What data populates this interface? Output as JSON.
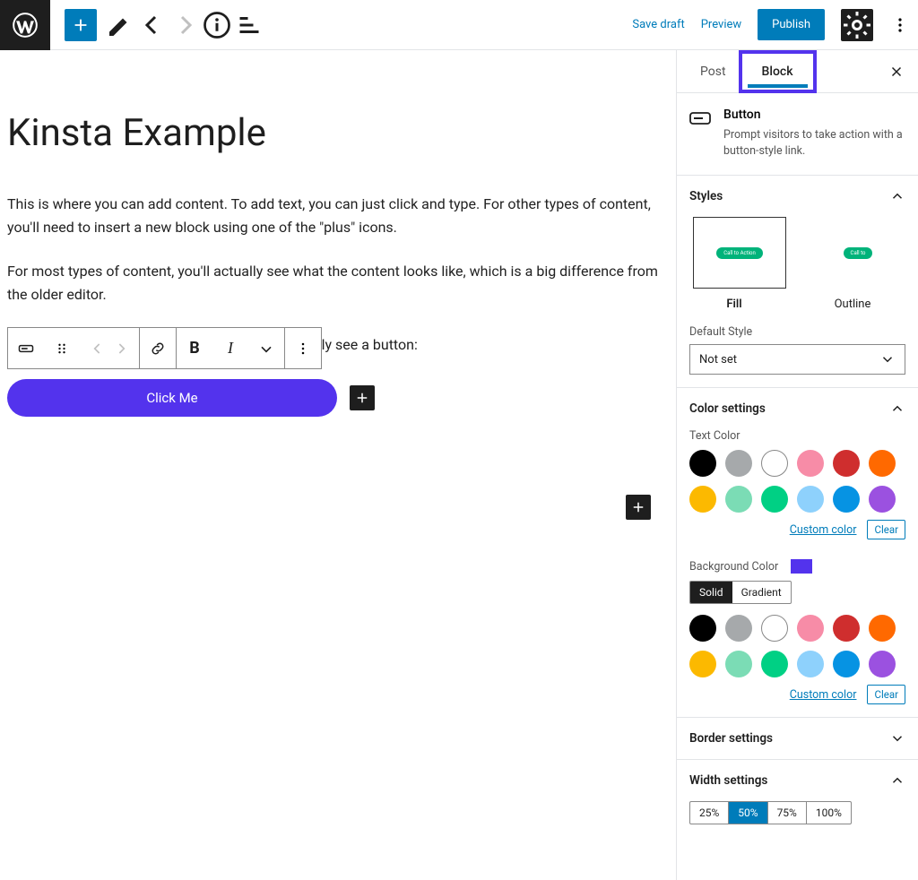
{
  "topbar": {
    "save_draft": "Save draft",
    "preview": "Preview",
    "publish": "Publish"
  },
  "editor": {
    "title": "Kinsta Example",
    "para1": "This is where you can add content. To add text, you can just click and type. For other types of content, you'll need to insert a new block using one of the \"plus\" icons.",
    "para2": "For most types of content, you'll actually see what the content looks like, which is a big difference from the older editor.",
    "toolbar_behind_text": "ally see a button:",
    "button_label": "Click Me"
  },
  "sidebar": {
    "tabs": {
      "post": "Post",
      "block": "Block"
    },
    "block_summary": {
      "title": "Button",
      "desc": "Prompt visitors to take action with a button-style link."
    },
    "styles": {
      "heading": "Styles",
      "options": {
        "fill": "Fill",
        "outline": "Outline"
      },
      "default_style_label": "Default Style",
      "default_style_value": "Not set"
    },
    "color": {
      "heading": "Color settings",
      "text_label": "Text Color",
      "bg_label": "Background Color",
      "custom": "Custom color",
      "clear": "Clear",
      "solid": "Solid",
      "gradient": "Gradient",
      "bg_value": "#5333ed",
      "palette": [
        "#000000",
        "#a6a9ab",
        "#ffffff",
        "#f78ca7",
        "#cf2e2e",
        "#ff6900",
        "#fcb900",
        "#7bdcb5",
        "#00d084",
        "#8ed1fc",
        "#0693e3",
        "#9b51e0"
      ]
    },
    "border": {
      "heading": "Border settings"
    },
    "width": {
      "heading": "Width settings",
      "options": [
        "25%",
        "50%",
        "75%",
        "100%"
      ],
      "active": "50%"
    }
  }
}
